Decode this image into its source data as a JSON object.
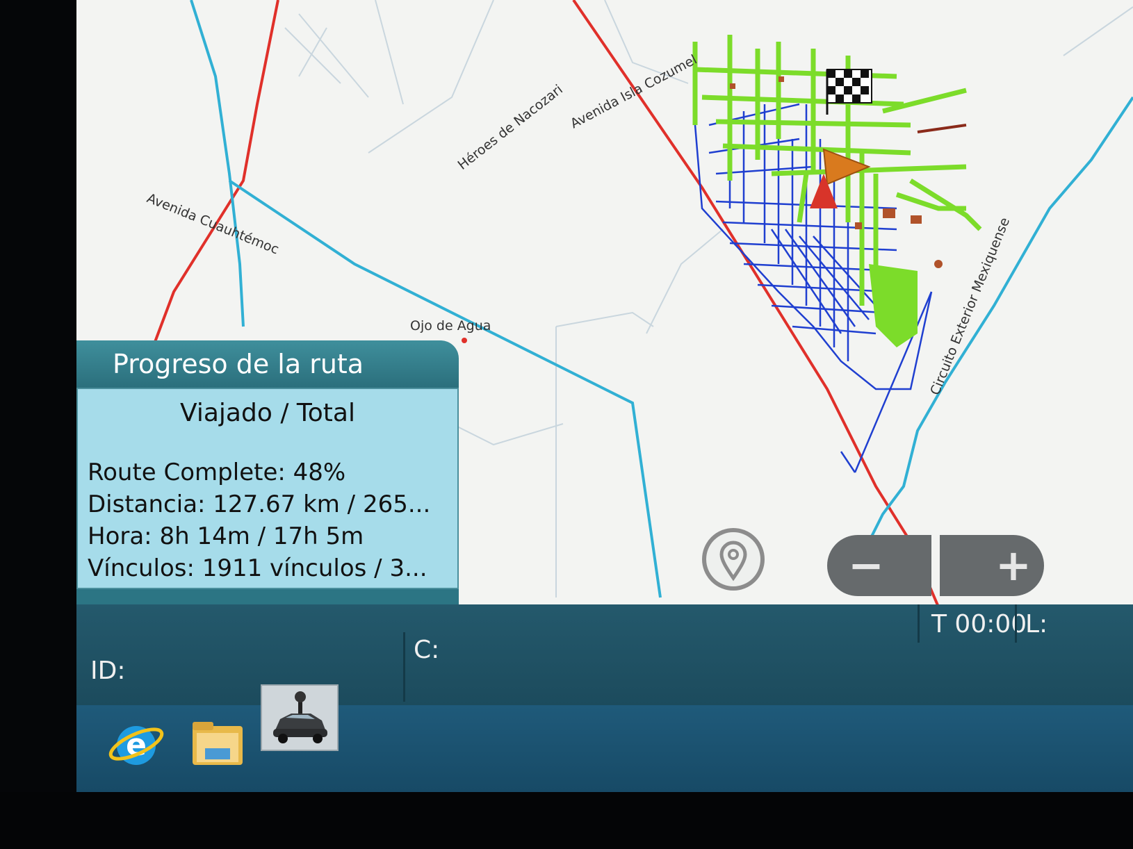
{
  "map": {
    "street_labels": {
      "heroes_nacozari": "Héroes de Nacozari",
      "avenida_isla_cozumel": "Avenida Isla Cozumel",
      "avenida_cuauhtemoc": "Avenida Cuauhtémoc",
      "ojo_de_agua": "Ojo de Agua",
      "circuito_exterior": "Circuito Exterior Mexiquense"
    },
    "colors": {
      "road_red": "#e0302a",
      "road_cyan": "#31b0d4",
      "route_blue": "#1f3fd0",
      "route_green": "#7cdc2a",
      "poi_brown": "#b0522a",
      "vehicle_orange": "#d97a1e"
    },
    "icons": [
      "finish-flag-icon",
      "vehicle-position-icon",
      "start-marker-icon"
    ]
  },
  "route_panel": {
    "title": "Progreso de la ruta",
    "subtitle": "Viajado / Total",
    "route_complete": "Route Complete: 48%",
    "distance": "Distancia: 127.67 km / 265...",
    "time": "Hora: 8h 14m / 17h 5m",
    "links": "Vínculos: 1911 vínculos / 3...",
    "progress_fraction": 0.48
  },
  "controls": {
    "location_icon": "location-pin-icon",
    "zoom_out_label": "−",
    "zoom_in_label": "+"
  },
  "status_bar": {
    "id_label": "ID:",
    "c_label": "C:",
    "time_label": "T 00:00",
    "l_label": "L:"
  },
  "taskbar": {
    "icons": [
      "internet-explorer-icon",
      "file-explorer-icon",
      "street-view-car-app-icon"
    ]
  }
}
